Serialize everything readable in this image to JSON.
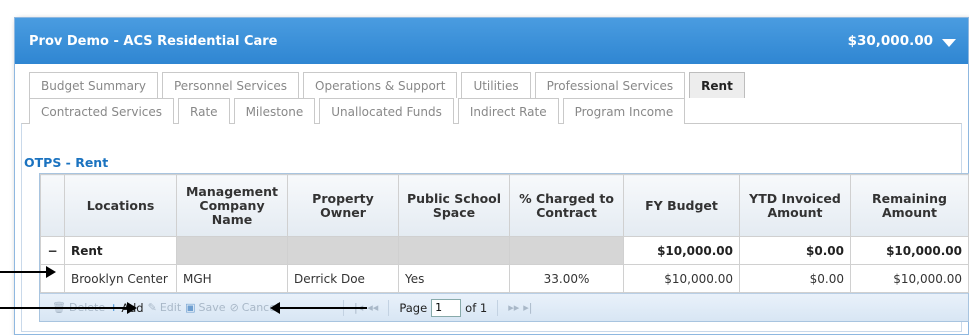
{
  "header": {
    "title": "Prov Demo - ACS Residential Care",
    "amount": "$30,000.00"
  },
  "tabs_row1": [
    "Budget Summary",
    "Personnel Services",
    "Operations & Support",
    "Utilities",
    "Professional Services",
    "Rent"
  ],
  "tabs_row2": [
    "Contracted Services",
    "Rate",
    "Milestone",
    "Unallocated Funds",
    "Indirect Rate",
    "Program Income"
  ],
  "active_tab": "Rent",
  "section_title": "OTPS - Rent",
  "columns": [
    "Locations",
    "Management Company Name",
    "Property Owner",
    "Public School Space",
    "% Charged to Contract",
    "FY Budget",
    "YTD Invoiced Amount",
    "Remaining Amount"
  ],
  "group": {
    "expander": "−",
    "label": "Rent",
    "fy_budget": "$10,000.00",
    "ytd": "$0.00",
    "remaining": "$10,000.00"
  },
  "row": {
    "location": "Brooklyn Center",
    "mgmt": "MGH",
    "owner": "Derrick Doe",
    "school": "Yes",
    "pct": "33.00%",
    "fy_budget": "$10,000.00",
    "ytd": "$0.00",
    "remaining": "$10,000.00"
  },
  "pager": {
    "delete": "Delete",
    "add": "Add",
    "edit": "Edit",
    "save": "Save",
    "cancel": "Cancel",
    "page_label": "Page",
    "page_value": "1",
    "of_label": "of 1"
  }
}
